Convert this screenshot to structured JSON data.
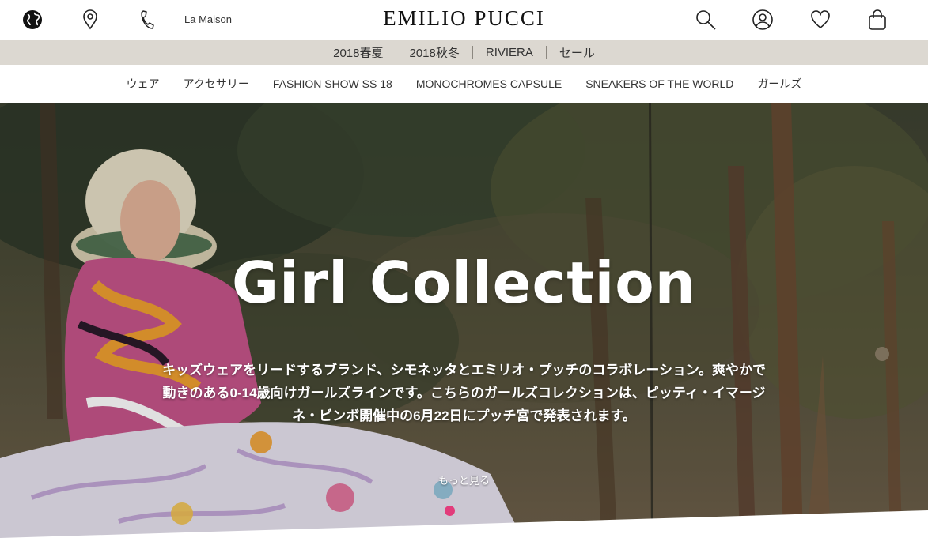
{
  "topbar": {
    "icons": {
      "globe": "globe-icon",
      "location": "location-pin-icon",
      "phone": "phone-icon",
      "search": "search-icon",
      "account": "account-icon",
      "wishlist": "heart-icon",
      "bag": "shopping-bag-icon"
    },
    "maison_label": "La Maison",
    "logo": "EMILIO PUCCI"
  },
  "seasons": [
    "2018春夏",
    "2018秋冬",
    "RIVIERA",
    "セール"
  ],
  "categories": [
    "ウェア",
    "アクセサリー",
    "FASHION SHOW SS 18",
    "MONOCHROMES CAPSULE",
    "SNEAKERS OF THE WORLD",
    "ガールズ"
  ],
  "hero": {
    "title": "Girl Collection",
    "description": "キッズウェアをリードするブランド、シモネッタとエミリオ・プッチのコラボレーション。爽やかで動きのある0-14歳向けガールズラインです。こちらのガールズコレクションは、ピッティ・イマージネ・ビンボ開催中の6月22日にプッチ宮で発表されます。",
    "more_label": "もっと見る",
    "accent_color": "#e23c7b"
  }
}
